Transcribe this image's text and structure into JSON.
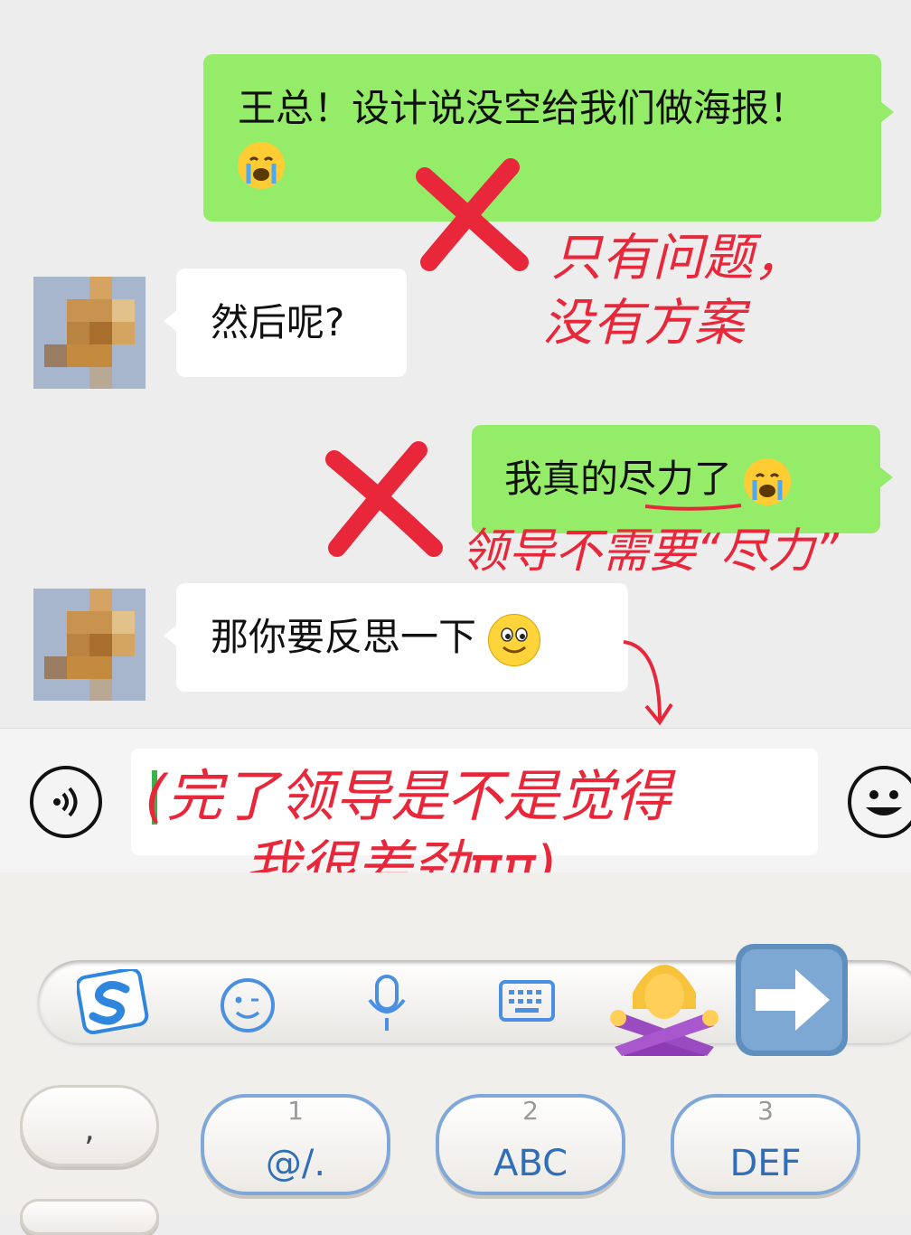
{
  "messages": [
    {
      "side": "right",
      "text": "王总！设计说没空给我们做海报！",
      "emoji": "crying-face"
    },
    {
      "side": "left",
      "text": "然后呢?"
    },
    {
      "side": "right",
      "text": "我真的尽力了",
      "emoji": "crying-face"
    },
    {
      "side": "left",
      "text": "那你要反思一下",
      "emoji": "smiling-face"
    }
  ],
  "annotations": {
    "note1_line1": "只有问题，",
    "note1_line2": "没有方案",
    "note2": "领导不需要“尽力”",
    "note3_line1": "(完了领导是不是觉得",
    "note3_line2": "我很差劲ππ)"
  },
  "input_bar": {
    "voice_icon": "voice-icon",
    "emoji_icon": "emoji-icon"
  },
  "ime": {
    "toolbar": [
      "sogou-logo-icon",
      "emoji-icon",
      "microphone-icon",
      "keyboard-icon"
    ],
    "keys": [
      {
        "num": "",
        "label": ","
      },
      {
        "num": "1",
        "label": "@/."
      },
      {
        "num": "2",
        "label": "ABC"
      },
      {
        "num": "3",
        "label": "DEF"
      }
    ]
  },
  "colors": {
    "sent_bubble": "#95ec69",
    "received_bubble": "#ffffff",
    "annotation": "#e8283a",
    "chat_bg": "#ededed",
    "key_text": "#2f6fb8"
  }
}
